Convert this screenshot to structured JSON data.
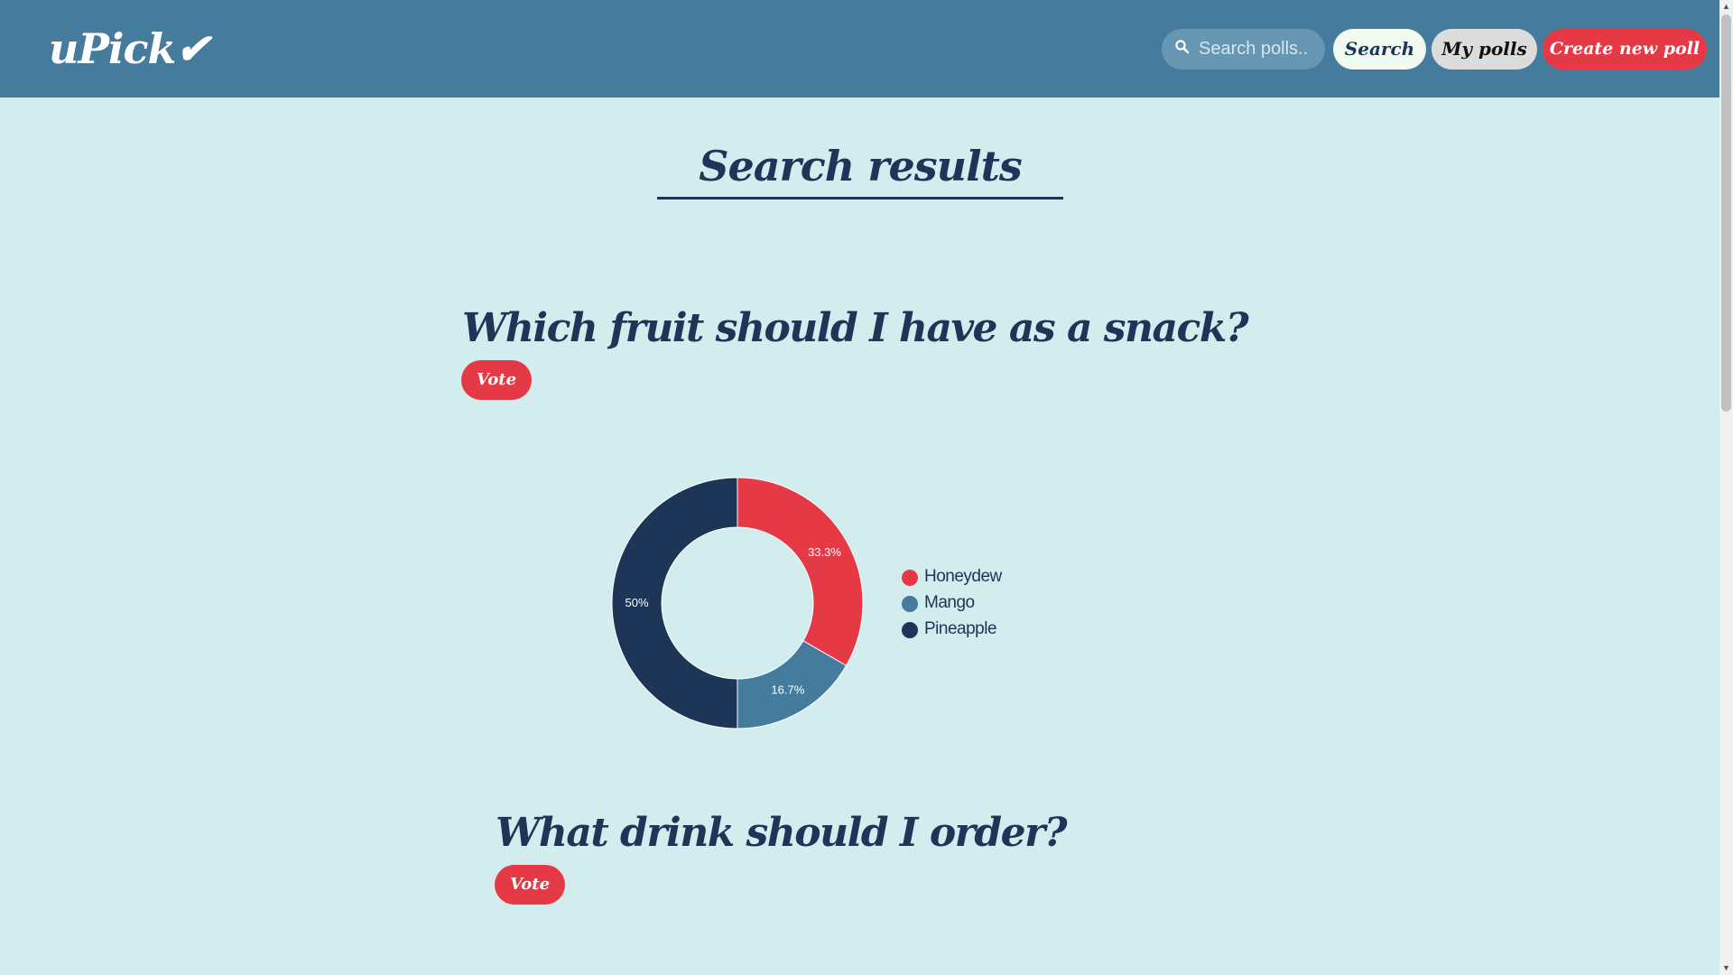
{
  "header": {
    "logo": "uPick✔",
    "search": {
      "placeholder": "Search polls.."
    },
    "search_button": "Search",
    "my_polls_button": "My polls",
    "create_button": "Create new poll"
  },
  "main": {
    "title": "Search results",
    "polls": [
      {
        "question": "Which fruit should I have as a snack?",
        "vote_label": "Vote"
      },
      {
        "question": "What drink should I order?",
        "vote_label": "Vote"
      }
    ]
  },
  "colors": {
    "header_bg": "#457b9d",
    "page_bg": "#d3ecee",
    "accent_red": "#e63946",
    "navy": "#1d3557",
    "steel_blue": "#457b9d"
  },
  "icons": {
    "search": "search-icon",
    "scroll_up": "chevron-up-icon",
    "scroll_down": "chevron-down-icon"
  },
  "chart_data": {
    "type": "pie",
    "categories": [
      "Honeydew",
      "Mango",
      "Pineapple"
    ],
    "values": [
      33.3,
      16.7,
      50
    ],
    "labels": [
      "33.3%",
      "16.7%",
      "50%"
    ],
    "colors": [
      "#e63946",
      "#457b9d",
      "#1d3557"
    ],
    "donut": true,
    "legend_position": "right"
  }
}
